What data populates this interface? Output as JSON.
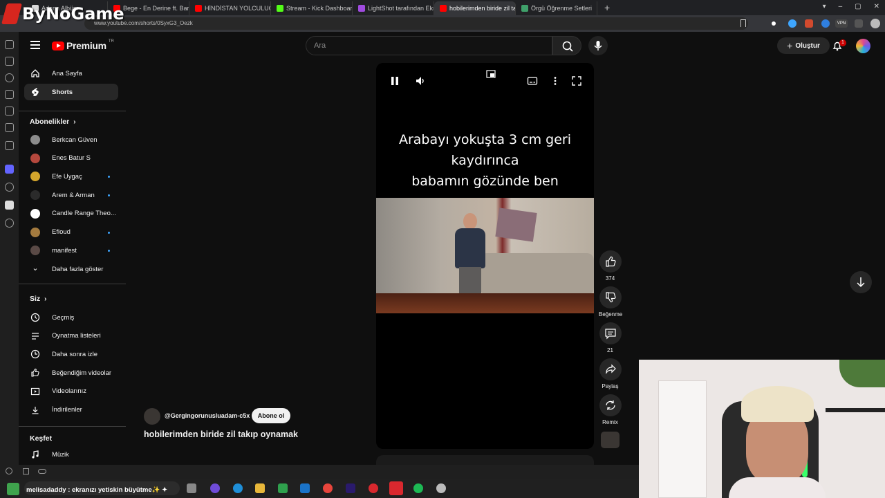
{
  "overlay": {
    "logo_text": "ByNoGame"
  },
  "browser": {
    "tabs": [
      {
        "label": "Adana Albüm",
        "color": "#d9d9d9"
      },
      {
        "label": "Bege - En Derine ft. Baran C",
        "color": "#ff0000"
      },
      {
        "label": "HİNDİSTAN YOLCULUĞU V",
        "color": "#ff0000"
      },
      {
        "label": "Stream - Kick Dashboard",
        "color": "#53fc18"
      },
      {
        "label": "LightShot tarafından Ekran",
        "color": "#a04be0"
      },
      {
        "label": "hobilerimden biride zil takı",
        "color": "#ff0000",
        "active": true
      },
      {
        "label": "Örgü Öğrenme Setleri",
        "color": "#3fa06a"
      }
    ],
    "url": "www.youtube.com/shorts/0SyxG3_Oezk"
  },
  "header": {
    "logo_text": "Premium",
    "region": "TR",
    "search_placeholder": "Ara",
    "create_label": "Oluştur",
    "notifications_count": "1"
  },
  "sidebar": {
    "main": [
      {
        "label": "Ana Sayfa",
        "icon": "home-icon"
      },
      {
        "label": "Shorts",
        "icon": "shorts-icon",
        "selected": true
      }
    ],
    "subscriptions_title": "Abonelikler",
    "subscriptions": [
      {
        "label": "Berkcan Güven",
        "color": "#8c8c8c",
        "dot": false
      },
      {
        "label": "Enes Batur S",
        "color": "#b5483d",
        "dot": false
      },
      {
        "label": "Efe Uygaç",
        "color": "#d4a52c",
        "dot": true
      },
      {
        "label": "Arem & Arman",
        "color": "#2b2b2b",
        "dot": true
      },
      {
        "label": "Candle Range Theo...",
        "color": "#ffffff",
        "dot": false
      },
      {
        "label": "Efloud",
        "color": "#a47b3f",
        "dot": true
      },
      {
        "label": "manifest",
        "color": "#5a4a46",
        "dot": true
      }
    ],
    "show_more_label": "Daha fazla göster",
    "you_title": "Siz",
    "you_items": [
      {
        "label": "Geçmiş",
        "icon": "history-icon"
      },
      {
        "label": "Oynatma listeleri",
        "icon": "playlists-icon"
      },
      {
        "label": "Daha sonra izle",
        "icon": "watch-later-icon"
      },
      {
        "label": "Beğendiğim videolar",
        "icon": "liked-icon"
      },
      {
        "label": "Videolarınız",
        "icon": "your-videos-icon"
      },
      {
        "label": "İndirilenler",
        "icon": "downloads-icon"
      }
    ],
    "explore_title": "Keşfet",
    "explore_items": [
      {
        "label": "Müzik",
        "icon": "music-icon"
      }
    ]
  },
  "short": {
    "caption_lines": [
      "Arabayı yokuşta 3 cm geri",
      "kaydırınca",
      "babamın gözünde ben"
    ],
    "channel": "@Gergingorunusluadam-c5x",
    "subscribe_label": "Abone ol",
    "title": "hobilerimden biride zil takıp oynamak",
    "likes": "374",
    "dislike_label": "Beğenme",
    "comments": "21",
    "share_label": "Paylaş",
    "remix_label": "Remix"
  },
  "taskbar": {
    "ticker": "melisadaddy : ekranızı yetiskin büyütme✨ ✦"
  }
}
